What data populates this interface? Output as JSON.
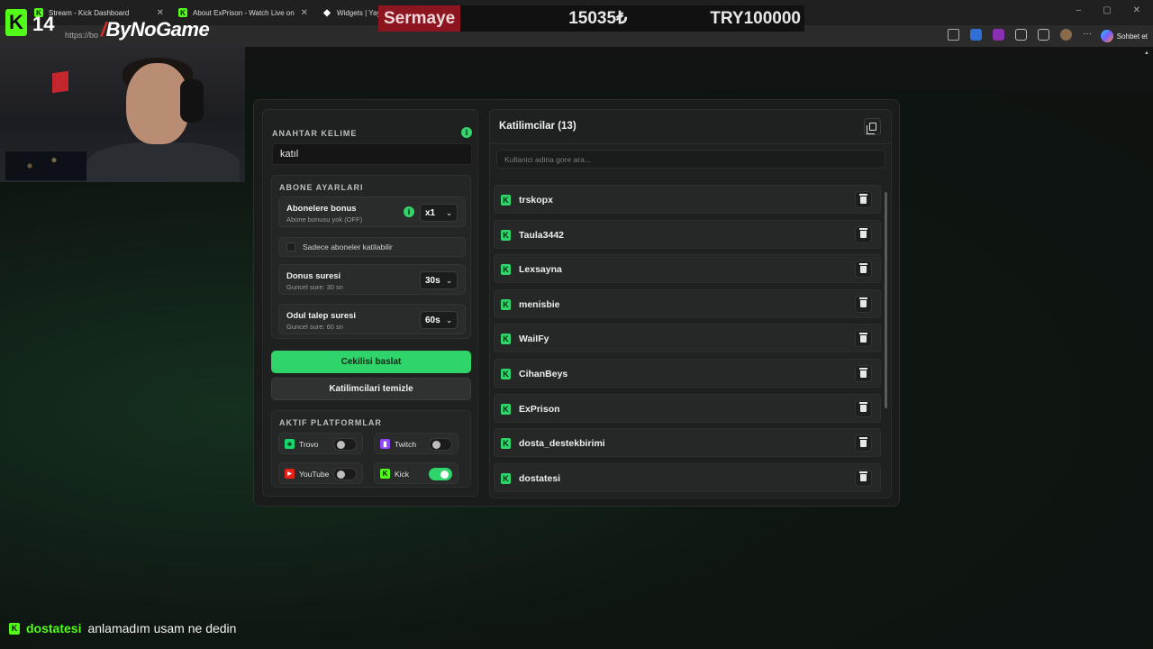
{
  "browser": {
    "tabs": [
      {
        "title": "Stream - Kick Dashboard",
        "icon": "kick-icon"
      },
      {
        "title": "About ExPrison - Watch Live on Ki",
        "icon": "kick-icon"
      },
      {
        "title": "Widgets | Yayn",
        "icon": "widgets-icon"
      }
    ],
    "url": "https://bo",
    "profile_button": "Sohbet et"
  },
  "overlay": {
    "viewer_count": "14",
    "sponsor": "ByNoGame",
    "sermaye_label": "Sermaye",
    "sermaye_amount": "15035₺",
    "sermaye_target": "TRY100000",
    "chat": {
      "user": "dostatesi",
      "message": "anlamadım usam ne dedin"
    }
  },
  "giveaway": {
    "keyword": {
      "title": "ANAHTAR KELIME",
      "value": "katıl",
      "info": "i"
    },
    "subscriber_settings": {
      "title": "ABONE AYARLARI",
      "bonus": {
        "title": "Abonelere bonus",
        "subtitle": "Abone bonusu yok (OFF)",
        "value": "x1",
        "info": "i"
      },
      "only_subs": {
        "label": "Sadece aboneler katilabilir",
        "checked": false
      },
      "draw_time": {
        "title": "Donus suresi",
        "subtitle": "Guncel sure: 30 sn",
        "value": "30s"
      },
      "claim_time": {
        "title": "Odul talep suresi",
        "subtitle": "Guncel sure: 60 sn",
        "value": "60s"
      }
    },
    "start_button": "Cekilisi baslat",
    "clear_button": "Katilimcilari temizle",
    "platforms": {
      "title": "AKTIF PLATFORMLAR",
      "items": [
        {
          "name": "Trovo",
          "enabled": false,
          "color": "#19d66b",
          "icon": "trovo-icon"
        },
        {
          "name": "Twitch",
          "enabled": false,
          "color": "#9146ff",
          "icon": "twitch-icon"
        },
        {
          "name": "YouTube",
          "enabled": false,
          "color": "#e62117",
          "icon": "youtube-icon"
        },
        {
          "name": "Kick",
          "enabled": true,
          "color": "#53fc18",
          "icon": "kick-icon"
        }
      ]
    }
  },
  "participants": {
    "title": "Katilimcilar (13)",
    "search_placeholder": "Kullanici adina gore ara...",
    "items": [
      {
        "name": "trskopx"
      },
      {
        "name": "Taula3442"
      },
      {
        "name": "Lexsayna"
      },
      {
        "name": "menisbie"
      },
      {
        "name": "WaiIFy"
      },
      {
        "name": "CihanBeys"
      },
      {
        "name": "ExPrison"
      },
      {
        "name": "dosta_destekbirimi"
      },
      {
        "name": "dostatesi"
      }
    ]
  },
  "colors": {
    "accent": "#2fd46a",
    "kick": "#53fc18",
    "sermaye_red": "#8c1520"
  }
}
